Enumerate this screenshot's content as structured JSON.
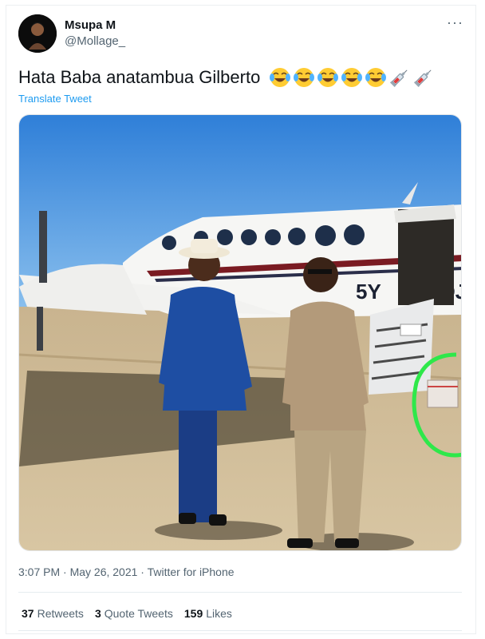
{
  "tweet": {
    "author_name": "Msupa M",
    "author_handle": "@Mollage_",
    "more_label": "···",
    "text": "Hata Baba anatambua Gilberto",
    "emoji_icons": [
      "face-with-tears-of-joy",
      "face-with-tears-of-joy",
      "face-with-tears-of-joy",
      "face-with-tears-of-joy",
      "face-with-tears-of-joy",
      "syringe",
      "syringe"
    ],
    "translate_label": "Translate Tweet",
    "photo": {
      "aircraft_registration_visible": "5Y",
      "aircraft_registration_tail": "DJ"
    },
    "meta": "3:07 PM · May 26, 2021 · Twitter for iPhone",
    "stats": [
      {
        "count": "37",
        "label": "Retweets"
      },
      {
        "count": "3",
        "label": "Quote Tweets"
      },
      {
        "count": "159",
        "label": "Likes"
      }
    ]
  },
  "colors": {
    "link": "#1d9bf0",
    "secondary_text": "#536471",
    "highlight_circle": "#2ee84a"
  }
}
